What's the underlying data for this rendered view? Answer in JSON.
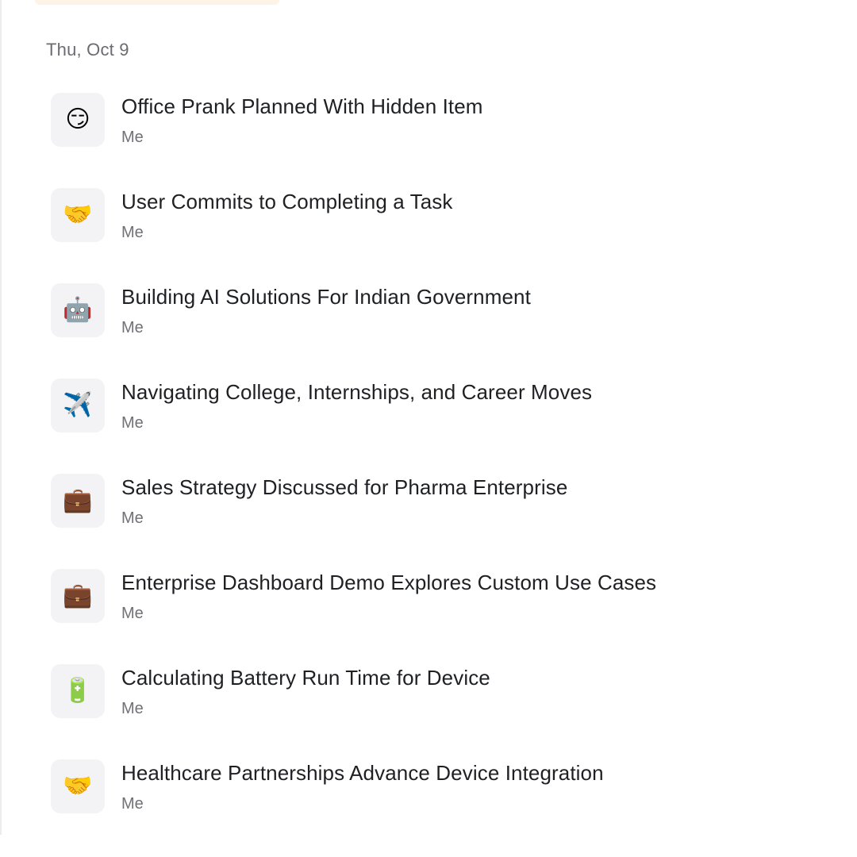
{
  "date_group": "Thu, Oct 9",
  "conversations": [
    {
      "emoji": "😏",
      "icon": "smirking-face-icon",
      "title": "Office Prank Planned With Hidden Item",
      "author": "Me"
    },
    {
      "emoji": "🤝",
      "icon": "handshake-icon",
      "title": "User Commits to Completing a Task",
      "author": "Me"
    },
    {
      "emoji": "🤖",
      "icon": "robot-icon",
      "title": "Building AI Solutions For Indian Government",
      "author": "Me"
    },
    {
      "emoji": "✈️",
      "icon": "airplane-icon",
      "title": "Navigating College, Internships, and Career Moves",
      "author": "Me"
    },
    {
      "emoji": "💼",
      "icon": "briefcase-icon",
      "title": "Sales Strategy Discussed for Pharma Enterprise",
      "author": "Me"
    },
    {
      "emoji": "💼",
      "icon": "briefcase-icon",
      "title": "Enterprise Dashboard Demo Explores Custom Use Cases",
      "author": "Me"
    },
    {
      "emoji": "🔋",
      "icon": "battery-icon",
      "title": "Calculating Battery Run Time for Device",
      "author": "Me"
    },
    {
      "emoji": "🤝",
      "icon": "handshake-icon",
      "title": "Healthcare Partnerships Advance Device Integration",
      "author": "Me"
    }
  ]
}
